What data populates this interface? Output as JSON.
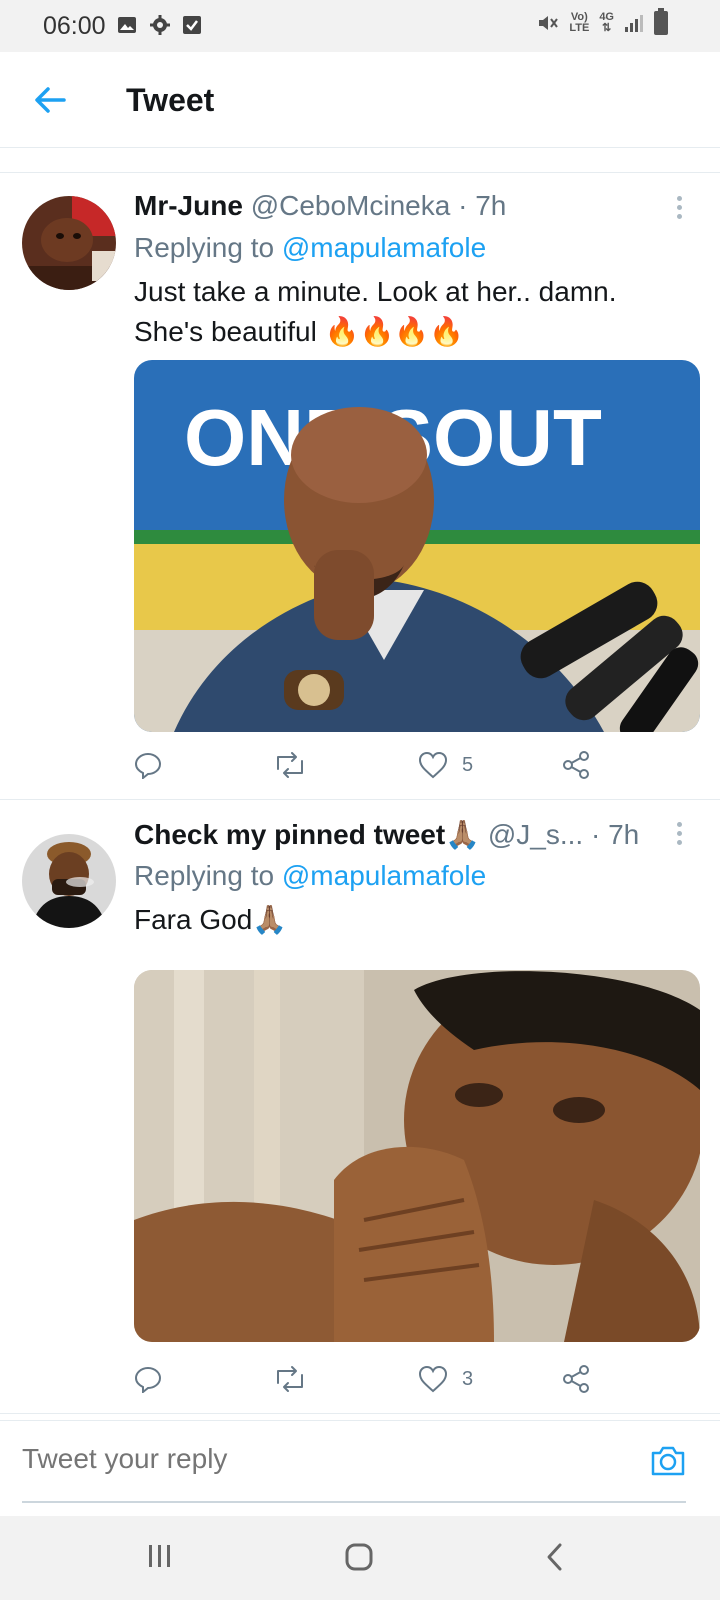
{
  "status_bar": {
    "time": "06:00",
    "volte": "Vo)",
    "lte": "LTE",
    "network": "4G"
  },
  "header": {
    "title": "Tweet",
    "back_icon": "arrow-left-icon"
  },
  "tweets": [
    {
      "display_name": "Mr-June",
      "handle": "@CeboMcineka",
      "separator": "·",
      "time": "7h",
      "replying_prefix": "Replying to",
      "replying_to": "@mapulamafole",
      "text_line1": "Just take a minute. Look at her.. damn.",
      "text_line2": "She's beautiful 🔥🔥🔥🔥",
      "image_overlay_text": "ONE SOUT",
      "likes": "5"
    },
    {
      "display_name": "Check my pinned tweet🙏🏽",
      "handle": "@J_s...",
      "separator": "·",
      "time": "7h",
      "replying_prefix": "Replying to",
      "replying_to": "@mapulamafole",
      "text_line1": "Fara God🙏🏽",
      "likes": "3"
    }
  ],
  "reply_bar": {
    "placeholder": "Tweet your reply",
    "camera_icon": "camera-icon"
  },
  "colors": {
    "accent": "#1da1f2",
    "secondary_text": "#657786",
    "primary_text": "#14171a",
    "divider": "#e6ecf0"
  }
}
